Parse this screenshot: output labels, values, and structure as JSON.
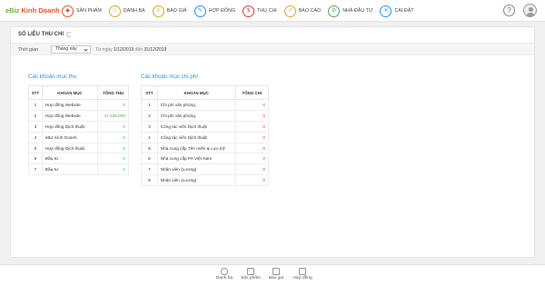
{
  "brand": {
    "prefix": "eBiz",
    "name": "Kinh Doanh"
  },
  "nav": [
    {
      "label": "SẢN PHẨM",
      "icon": "cube-icon",
      "color": "#e8532d",
      "glyph": "◆"
    },
    {
      "label": "DANH BẠ",
      "icon": "contacts-icon",
      "color": "#e8a22d",
      "glyph": "☺"
    },
    {
      "label": "BÁO GIÁ",
      "icon": "quote-icon",
      "color": "#e8a22d",
      "glyph": "≡"
    },
    {
      "label": "HỢP ĐỒNG",
      "icon": "contract-icon",
      "color": "#2196f3",
      "glyph": "✎"
    },
    {
      "label": "THU CHI",
      "icon": "money-icon",
      "color": "#e53935",
      "glyph": "$"
    },
    {
      "label": "BÁO CÁO",
      "icon": "report-icon",
      "color": "#e8a22d",
      "glyph": "↗"
    },
    {
      "label": "NHÀ ĐẦU TƯ",
      "icon": "investor-icon",
      "color": "#4caf50",
      "glyph": "⊘"
    },
    {
      "label": "CÀI ĐẶT",
      "icon": "settings-icon",
      "color": "#2196f3",
      "glyph": "✕"
    }
  ],
  "help_label": "?",
  "panel": {
    "title": "SỐ LIỆU THU CHI",
    "filter_label": "Thời gian",
    "filter_value": "Tháng này",
    "range_from_label": "Từ ngày",
    "range_from": "1/12/2019",
    "range_to_label": "đến",
    "range_to": "31/12/2019"
  },
  "income": {
    "title": "Các khoản mục thu",
    "headers": [
      "STT",
      "KHOẢN MỤC",
      "TỔNG THU"
    ],
    "rows": [
      [
        "1",
        "Hợp đồng Website",
        "0"
      ],
      [
        "2",
        "Hợp đồng Website",
        "47,168,000"
      ],
      [
        "3",
        "Hợp đồng Dịch thuật",
        "0"
      ],
      [
        "4",
        "eBiz Kinh Doanh",
        "0"
      ],
      [
        "5",
        "Hợp đồng Dịch thuật",
        "0"
      ],
      [
        "6",
        "Đầu tư",
        "0"
      ],
      [
        "7",
        "Đầu tư",
        "0"
      ]
    ]
  },
  "expense": {
    "title": "Các khoản mục chi phí",
    "headers": [
      "STT",
      "KHOẢN MỤC",
      "TỔNG CHI"
    ],
    "rows": [
      [
        "1",
        "Chi phí văn phòng",
        "0"
      ],
      [
        "2",
        "Chi phí văn phòng",
        "0"
      ],
      [
        "3",
        "Công tác viên Dịch thuật",
        "0"
      ],
      [
        "4",
        "Công tác viên Dịch thuật",
        "0"
      ],
      [
        "5",
        "Nhà cung cấp Tên miền & Lưu trữ",
        "0"
      ],
      [
        "6",
        "Nhà cung cấp PA Việt Nam",
        "0"
      ],
      [
        "7",
        "Nhân viên (Lương)",
        "0"
      ],
      [
        "8",
        "Nhân viên (Lương)",
        "0"
      ]
    ]
  },
  "bottom": [
    {
      "label": "Danh bạ",
      "icon": "contacts-icon"
    },
    {
      "label": "Sản phẩm",
      "icon": "cube-icon"
    },
    {
      "label": "Báo giá",
      "icon": "quote-icon"
    },
    {
      "label": "Hợp đồng",
      "icon": "folder-icon"
    }
  ],
  "colors": {
    "accent": "#2196f3",
    "positive": "#4caf50",
    "negative": "#e53935",
    "brand": "#6cb33f"
  }
}
